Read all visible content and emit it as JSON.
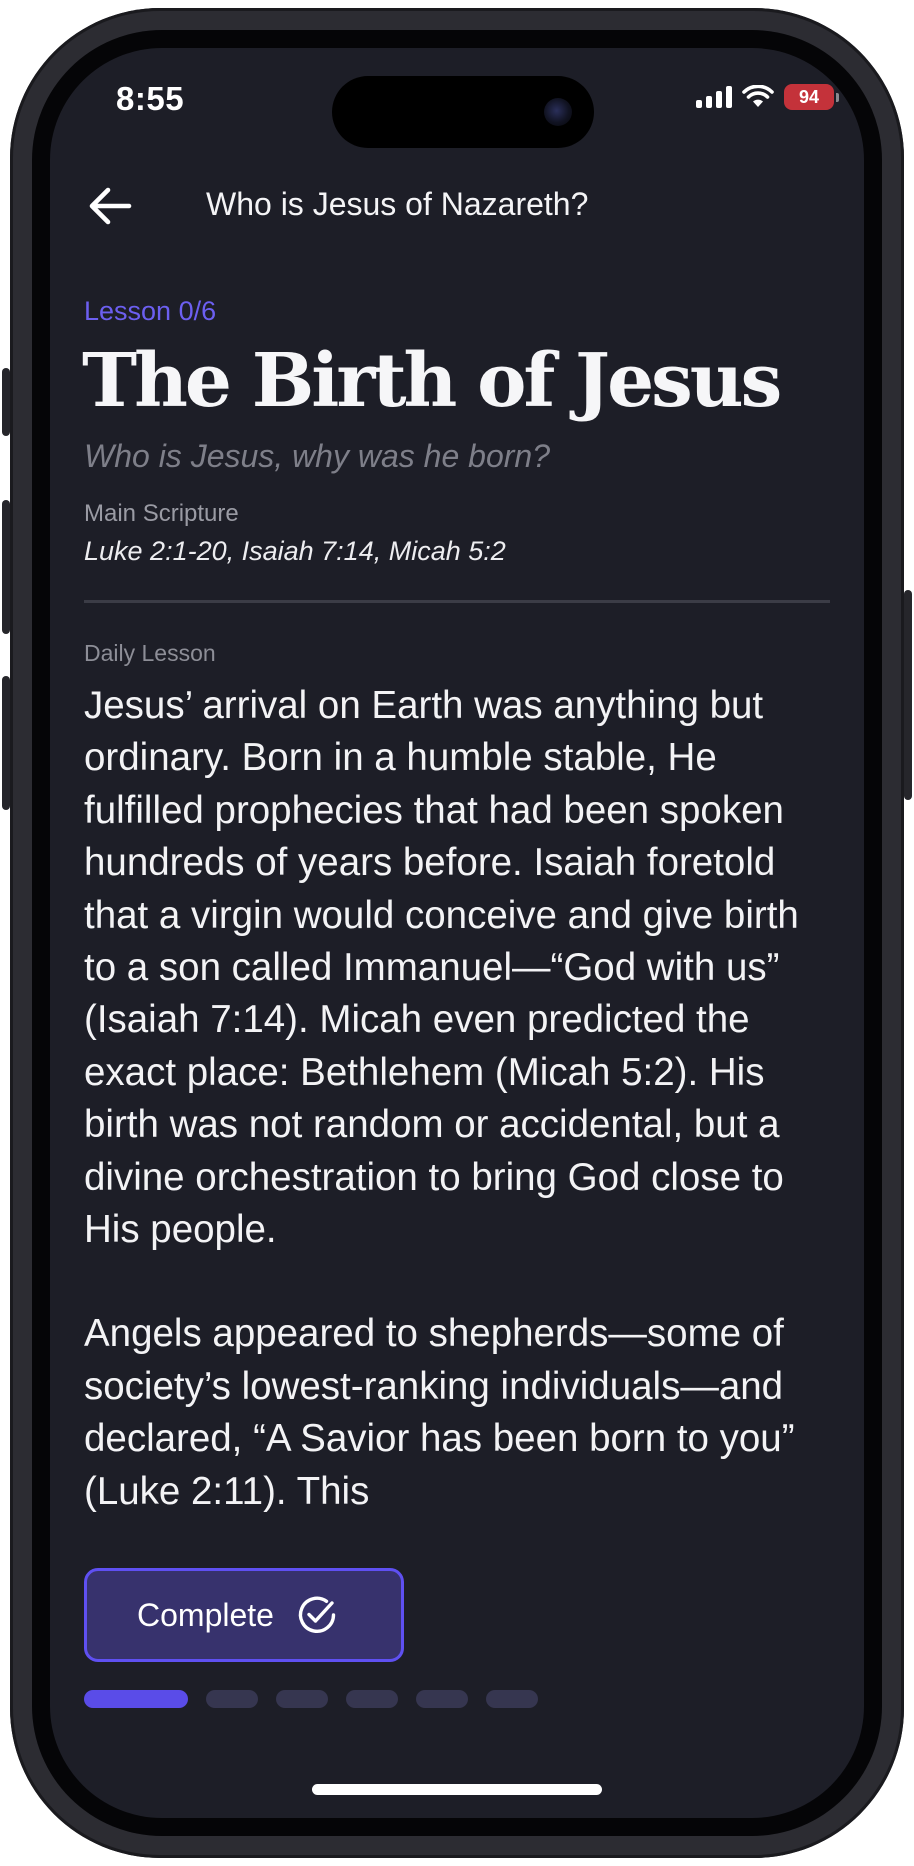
{
  "status_bar": {
    "time": "8:55",
    "battery": "94"
  },
  "header": {
    "title": "Who is Jesus of Nazareth?"
  },
  "lesson": {
    "progress_label": "Lesson 0/6",
    "title": "The Birth of Jesus",
    "subtitle": "Who is Jesus, why was he born?",
    "scripture_label": "Main Scripture",
    "scripture_refs": "Luke 2:1-20, Isaiah 7:14, Micah 5:2",
    "daily_label": "Daily Lesson",
    "paragraphs": [
      "Jesus’ arrival on Earth was anything but ordinary. Born in a humble stable, He fulfilled prophecies that had been spoken hundreds of years before. Isaiah foretold that a virgin would conceive and give birth to a son called Immanuel—“God with us” (Isaiah 7:14). Micah even predicted the exact place: Bethlehem (Micah 5:2). His birth was not random or accidental, but a divine orchestration to bring God close to His people.",
      "Angels appeared to shepherds—some of society’s lowest-ranking individuals—and declared, “A Savior has been born to you” (Luke 2:11). This"
    ]
  },
  "actions": {
    "complete_label": "Complete"
  },
  "progress": {
    "current_step": 1,
    "total_steps": 6
  },
  "colors": {
    "accent": "#5f50f2",
    "background": "#1d1e27",
    "button_fill": "#37326d",
    "battery_low": "#c4323a"
  },
  "icons": {
    "back": "arrow-left-icon",
    "complete": "check-circle-icon",
    "signal": "cellular-signal-icon",
    "wifi": "wifi-icon",
    "battery": "battery-charging-icon"
  }
}
